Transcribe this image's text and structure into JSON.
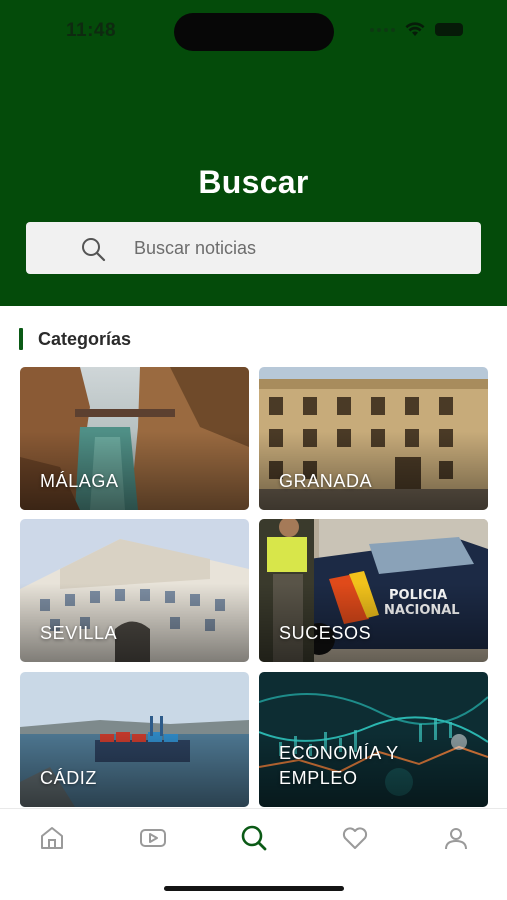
{
  "status_bar": {
    "time": "11:48"
  },
  "header": {
    "title": "Buscar"
  },
  "search": {
    "placeholder": "Buscar noticias"
  },
  "categories": {
    "heading": "Categorías",
    "items": [
      {
        "label": "MÁLAGA"
      },
      {
        "label": "GRANADA"
      },
      {
        "label": "SEVILLA"
      },
      {
        "label": "SUCESOS"
      },
      {
        "label": "CÁDIZ"
      },
      {
        "label": "ECONOMÍA Y\nEMPLEO"
      }
    ]
  },
  "bottom_nav": {
    "items": [
      {
        "icon": "home-icon",
        "active": false
      },
      {
        "icon": "video-icon",
        "active": false
      },
      {
        "icon": "search-icon",
        "active": true
      },
      {
        "icon": "heart-icon",
        "active": false
      },
      {
        "icon": "user-icon",
        "active": false
      }
    ]
  },
  "colors": {
    "brand_green": "#044b0a",
    "accent_green": "#0b5a16",
    "inactive_icon": "#9a9a9a"
  }
}
